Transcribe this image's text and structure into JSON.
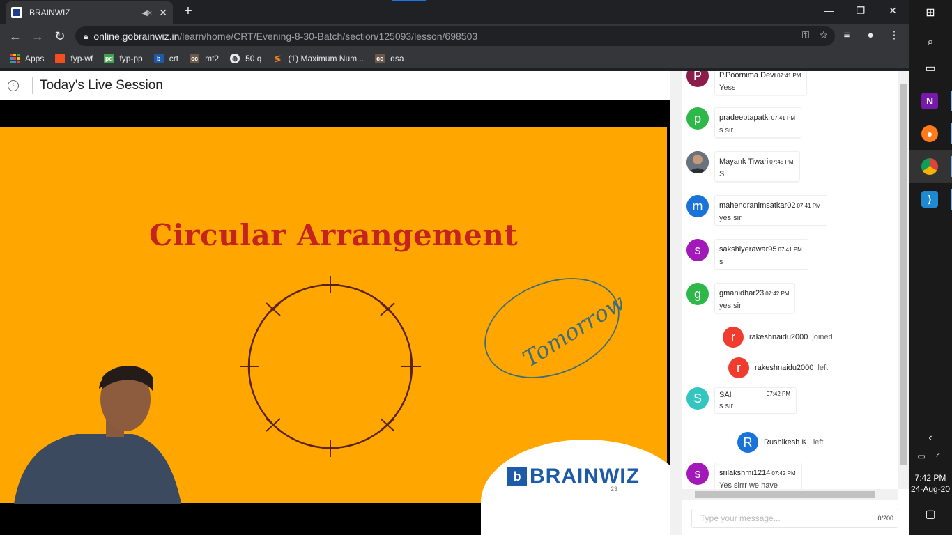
{
  "browser": {
    "tab_title": "BRAINWIZ",
    "new_tab": "+",
    "url_host": "online.gobrainwiz.in",
    "url_path": "/learn/home/CRT/Evening-8-30-Batch/section/125093/lesson/698503",
    "bookmarks": [
      {
        "label": "Apps",
        "icon": "apps-grid-icon"
      },
      {
        "label": "fyp-wf",
        "icon": "figma-icon",
        "color": "#f24e1e"
      },
      {
        "label": "fyp-pp",
        "icon": "pdf-icon",
        "color": "#3fa34d"
      },
      {
        "label": "crt",
        "icon": "brainwiz-icon",
        "color": "#1d5aa8"
      },
      {
        "label": "mt2",
        "icon": "cc-icon",
        "color": "#6b5a4a"
      },
      {
        "label": "50 q",
        "icon": "globe-icon",
        "color": "#e8eaed"
      },
      {
        "label": "(1) Maximum Num...",
        "icon": "stackoverflow-icon",
        "color": "#f48024"
      },
      {
        "label": "dsa",
        "icon": "cc-icon",
        "color": "#6b5a4a"
      }
    ]
  },
  "page": {
    "title": "Today's Live Session"
  },
  "slide": {
    "title": "Circular Arrangement",
    "handwriting": "Tomorrow",
    "brand": "BRAINWIZ",
    "brand_mark": "b",
    "page_number": "23"
  },
  "chat": {
    "messages": [
      {
        "type": "msg",
        "avatar": "P",
        "color": "#8b1d4a",
        "name": "P.Poornima Devi",
        "time": "07:41 PM",
        "text": "Yess"
      },
      {
        "type": "msg",
        "avatar": "p",
        "color": "#2fb84a",
        "name": "pradeeptapatki",
        "time": "07:41 PM",
        "text": "s sir"
      },
      {
        "type": "msg",
        "avatar": "photo",
        "color": "#5a6470",
        "name": "Mayank Tiwari",
        "time": "07:45 PM",
        "text": "S"
      },
      {
        "type": "msg",
        "avatar": "m",
        "color": "#1a73d8",
        "name": "mahendranimsatkar02",
        "time": "07:41 PM",
        "text": "yes sir"
      },
      {
        "type": "msg",
        "avatar": "s",
        "color": "#a318b8",
        "name": "sakshiyerawar95",
        "time": "07:41 PM",
        "text": "s"
      },
      {
        "type": "msg",
        "avatar": "g",
        "color": "#2fb84a",
        "name": "gmanidhar23",
        "time": "07:42 PM",
        "text": "yes sir"
      },
      {
        "type": "sys",
        "avatar": "r",
        "color": "#f03c2e",
        "name": "rakeshnaidu2000",
        "action": "joined"
      },
      {
        "type": "sys",
        "avatar": "r",
        "color": "#f03c2e",
        "name": "rakeshnaidu2000",
        "action": "left"
      },
      {
        "type": "msg",
        "avatar": "S",
        "color": "#33c6c0",
        "name": "SAI",
        "time": "07:42 PM",
        "text": "s sir"
      },
      {
        "type": "sys",
        "avatar": "R",
        "color": "#1a73d8",
        "name": "Rushikesh K.",
        "action": "left"
      },
      {
        "type": "msg",
        "avatar": "s",
        "color": "#a318b8",
        "name": "srilakshmi1214",
        "time": "07:42 PM",
        "text": "Yes sirrr we have"
      }
    ],
    "input_placeholder": "Type your message...",
    "char_counter": "0/200"
  },
  "taskbar": {
    "time": "7:42 PM",
    "date": "24-Aug-20"
  }
}
